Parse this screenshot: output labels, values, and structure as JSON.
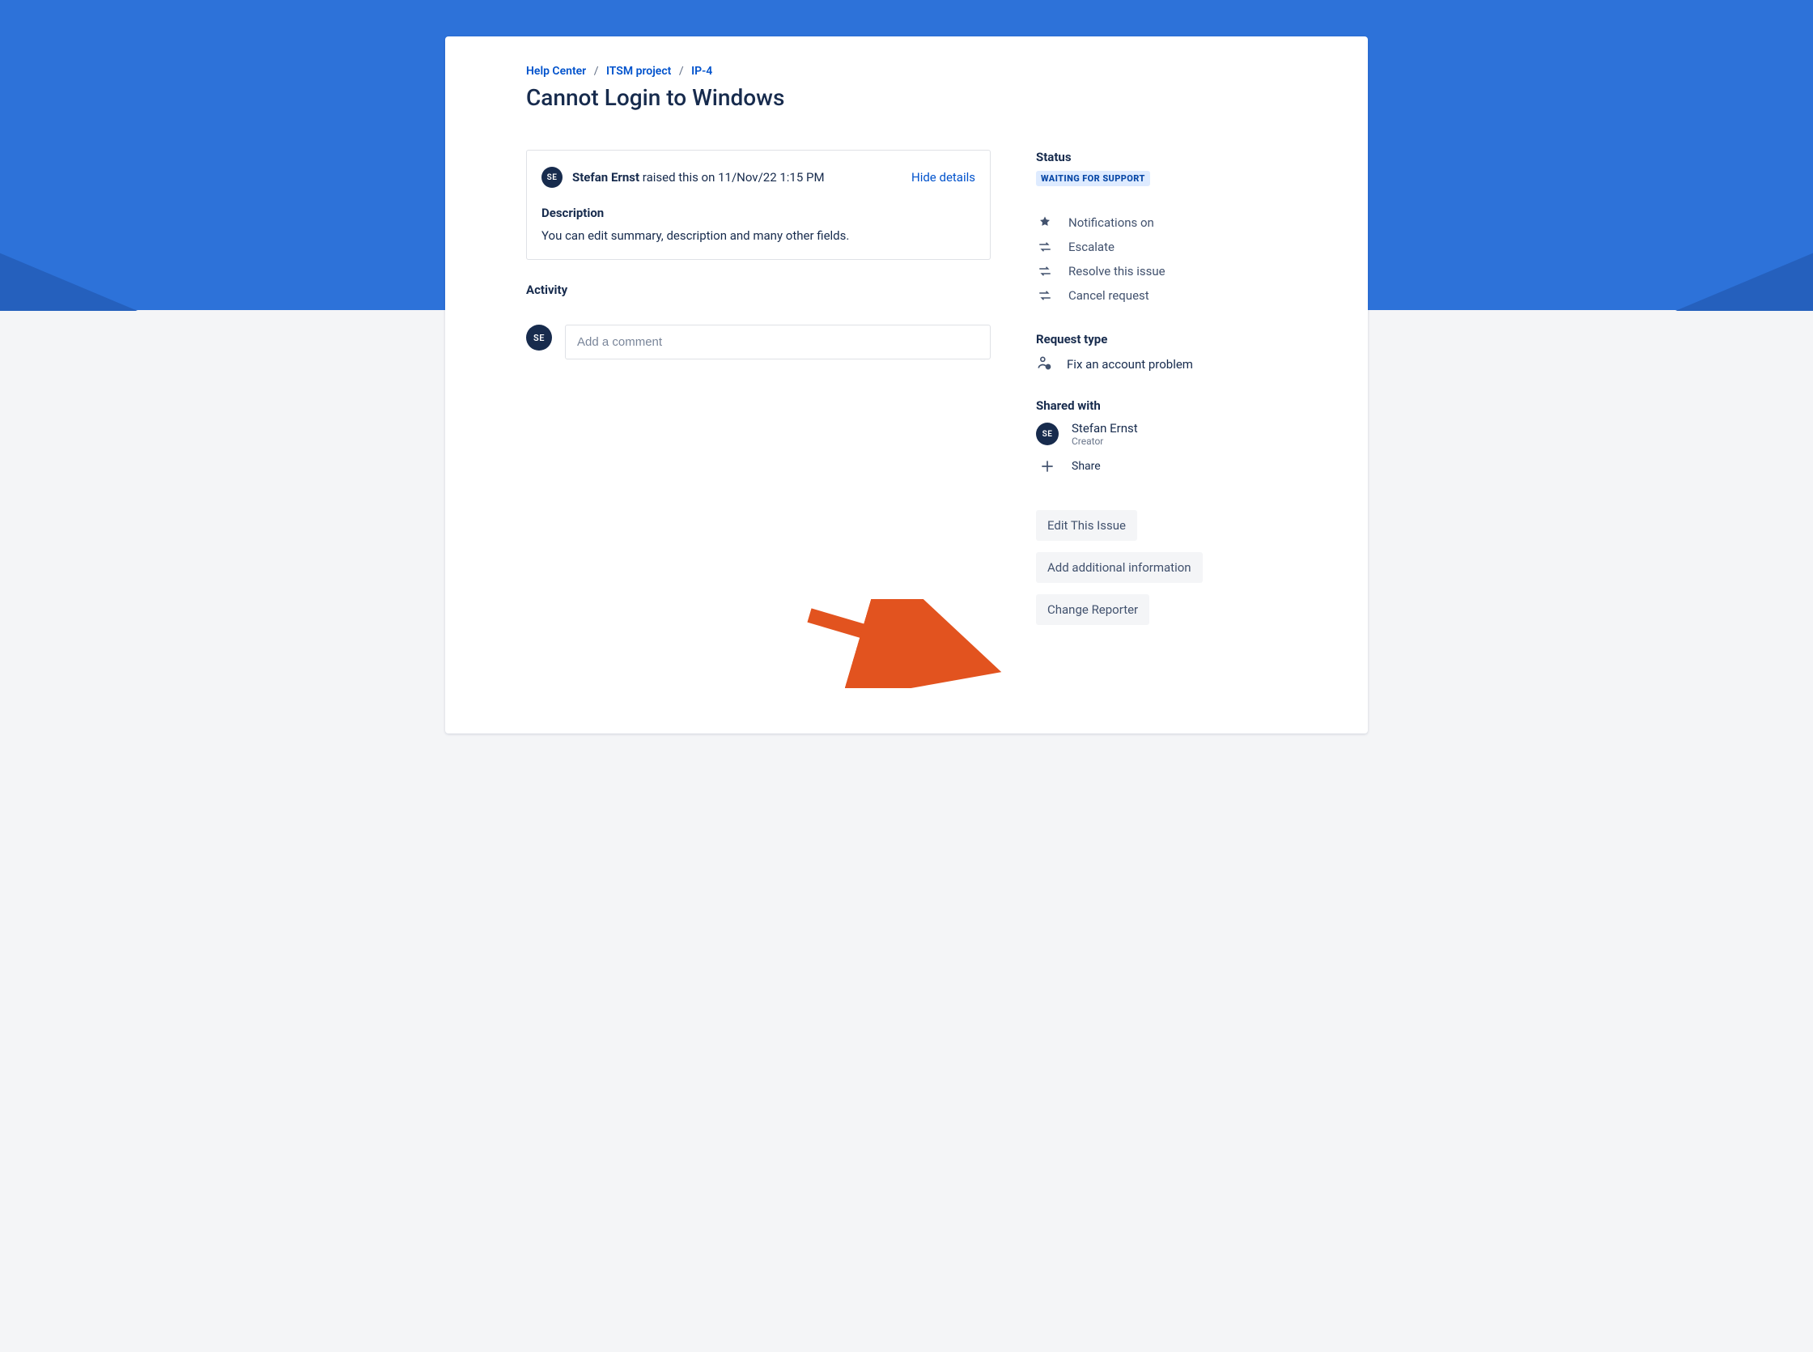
{
  "breadcrumb": {
    "help_center": "Help Center",
    "project": "ITSM project",
    "issue_key": "IP-4"
  },
  "title": "Cannot Login to Windows",
  "reporter": {
    "name": "Stefan Ernst",
    "initials": "SE",
    "raised_on": "11/Nov/22 1:15 PM",
    "raised_before": " raised this on "
  },
  "hide_details": "Hide details",
  "description_label": "Description",
  "description_text": "You can edit summary, description and many other fields.",
  "activity_label": "Activity",
  "comment_placeholder": "Add a comment",
  "status_label": "Status",
  "status_value": "WAITING FOR SUPPORT",
  "actions": {
    "notifications": "Notifications on",
    "escalate": "Escalate",
    "resolve": "Resolve this issue",
    "cancel": "Cancel request"
  },
  "request_type_label": "Request type",
  "request_type_value": "Fix an account problem",
  "shared_label": "Shared with",
  "shared_user": {
    "name": "Stefan Ernst",
    "initials": "SE",
    "role": "Creator"
  },
  "share_label": "Share",
  "buttons": {
    "edit": "Edit This Issue",
    "add_info": "Add additional information",
    "change_reporter": "Change Reporter"
  }
}
